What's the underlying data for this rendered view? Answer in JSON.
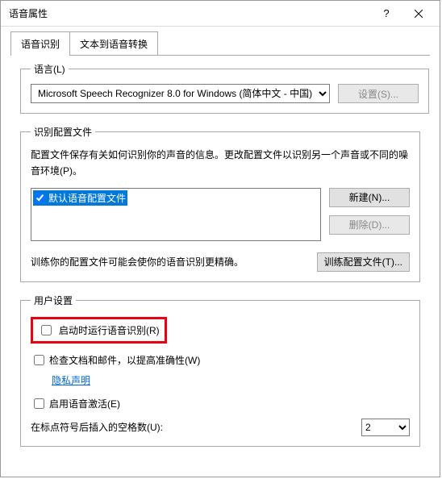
{
  "window": {
    "title": "语音属性"
  },
  "tabs": {
    "active": "语音识别",
    "inactive": "文本到语音转换"
  },
  "language": {
    "legend": "语言(L)",
    "selected": "Microsoft Speech Recognizer 8.0 for Windows (简体中文 - 中国)",
    "settings_btn": "设置(S)..."
  },
  "profiles": {
    "legend": "识别配置文件",
    "desc": "配置文件保存有关如何识别你的声音的信息。更改配置文件以识别另一个声音或不同的噪音环境(P)。",
    "default_item": "默认语音配置文件",
    "new_btn": "新建(N)...",
    "delete_btn": "删除(D)...",
    "train_desc": "训练你的配置文件可能会使你的语音识别更精确。",
    "train_btn": "训练配置文件(T)..."
  },
  "user": {
    "legend": "用户设置",
    "run_on_start": "启动时运行语音识别(R)",
    "review_docs": "检查文档和邮件，以提高准确性(W)",
    "privacy_link": "隐私声明",
    "enable_activate": "启用语音激活(E)",
    "spaces_label": "在标点符号后插入的空格数(U):",
    "spaces_value": "2"
  }
}
